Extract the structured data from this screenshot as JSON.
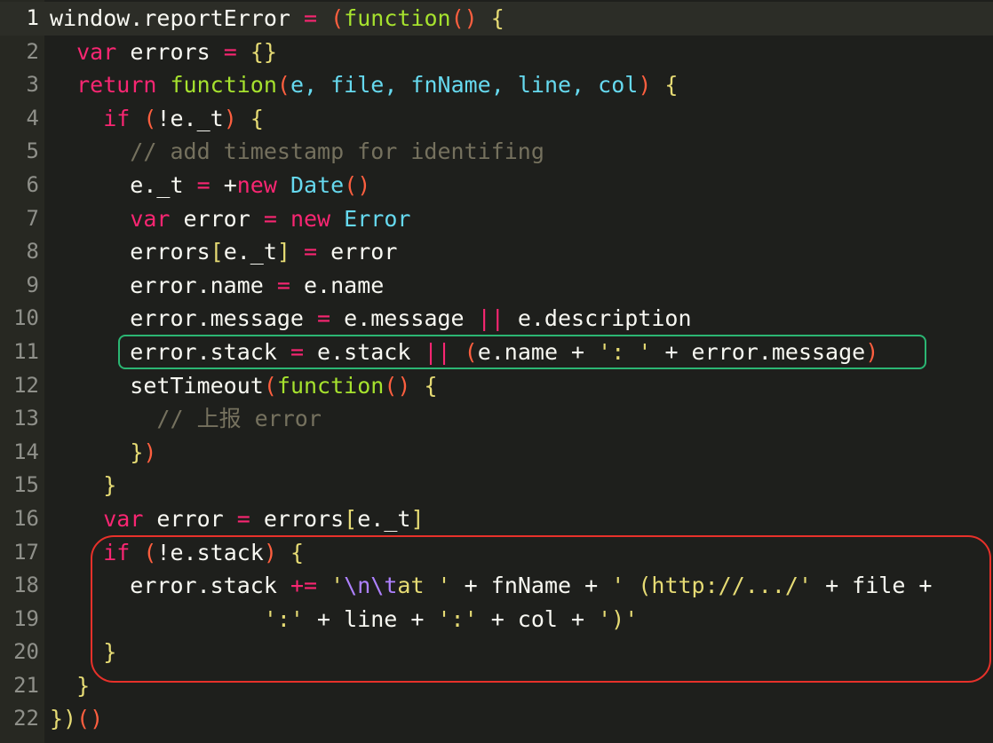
{
  "editor": {
    "line_numbers": [
      "1",
      "2",
      "3",
      "4",
      "5",
      "6",
      "7",
      "8",
      "9",
      "10",
      "11",
      "12",
      "13",
      "14",
      "15",
      "16",
      "17",
      "18",
      "19",
      "20",
      "21",
      "22"
    ],
    "active_line": "1",
    "colors": {
      "background": "#1e1f1c",
      "keyword": "#f92672",
      "function": "#a6e22e",
      "builtin": "#66d9ef",
      "string": "#e6db74",
      "comment": "#75715e",
      "highlight_green": "#2bb673",
      "highlight_red": "#e8312a"
    },
    "lines": [
      [
        {
          "t": "window.reportError ",
          "c": "w"
        },
        {
          "t": "=",
          "c": "k"
        },
        {
          "t": " ",
          "c": "w"
        },
        {
          "t": "(",
          "c": "p"
        },
        {
          "t": "function",
          "c": "f"
        },
        {
          "t": "()",
          "c": "p"
        },
        {
          "t": " {",
          "c": "y"
        }
      ],
      [
        {
          "t": "  ",
          "c": "w"
        },
        {
          "t": "var",
          "c": "k"
        },
        {
          "t": " errors ",
          "c": "w"
        },
        {
          "t": "=",
          "c": "k"
        },
        {
          "t": " ",
          "c": "w"
        },
        {
          "t": "{}",
          "c": "y"
        }
      ],
      [
        {
          "t": "  ",
          "c": "w"
        },
        {
          "t": "return",
          "c": "k"
        },
        {
          "t": " ",
          "c": "w"
        },
        {
          "t": "function",
          "c": "f"
        },
        {
          "t": "(",
          "c": "p"
        },
        {
          "t": "e, file, fnName, line, col",
          "c": "b"
        },
        {
          "t": ")",
          "c": "p"
        },
        {
          "t": " {",
          "c": "y"
        }
      ],
      [
        {
          "t": "    ",
          "c": "w"
        },
        {
          "t": "if",
          "c": "k"
        },
        {
          "t": " ",
          "c": "w"
        },
        {
          "t": "(",
          "c": "p"
        },
        {
          "t": "!e._t",
          "c": "w"
        },
        {
          "t": ")",
          "c": "p"
        },
        {
          "t": " {",
          "c": "y"
        }
      ],
      [
        {
          "t": "      // add timestamp for identifing",
          "c": "c"
        }
      ],
      [
        {
          "t": "      e._t ",
          "c": "w"
        },
        {
          "t": "=",
          "c": "k"
        },
        {
          "t": " +",
          "c": "w"
        },
        {
          "t": "new",
          "c": "k"
        },
        {
          "t": " ",
          "c": "w"
        },
        {
          "t": "Date",
          "c": "b"
        },
        {
          "t": "()",
          "c": "p"
        }
      ],
      [
        {
          "t": "      ",
          "c": "w"
        },
        {
          "t": "var",
          "c": "k"
        },
        {
          "t": " error ",
          "c": "w"
        },
        {
          "t": "=",
          "c": "k"
        },
        {
          "t": " ",
          "c": "w"
        },
        {
          "t": "new",
          "c": "k"
        },
        {
          "t": " ",
          "c": "w"
        },
        {
          "t": "Error",
          "c": "b"
        }
      ],
      [
        {
          "t": "      errors",
          "c": "w"
        },
        {
          "t": "[",
          "c": "y"
        },
        {
          "t": "e._t",
          "c": "w"
        },
        {
          "t": "]",
          "c": "y"
        },
        {
          "t": " ",
          "c": "w"
        },
        {
          "t": "=",
          "c": "k"
        },
        {
          "t": " error",
          "c": "w"
        }
      ],
      [
        {
          "t": "      error.name ",
          "c": "w"
        },
        {
          "t": "=",
          "c": "k"
        },
        {
          "t": " e.name",
          "c": "w"
        }
      ],
      [
        {
          "t": "      error.message ",
          "c": "w"
        },
        {
          "t": "=",
          "c": "k"
        },
        {
          "t": " e.message ",
          "c": "w"
        },
        {
          "t": "||",
          "c": "k"
        },
        {
          "t": " e.description",
          "c": "w"
        }
      ],
      [
        {
          "t": "      error.stack ",
          "c": "w"
        },
        {
          "t": "=",
          "c": "k"
        },
        {
          "t": " e.stack ",
          "c": "w"
        },
        {
          "t": "||",
          "c": "k"
        },
        {
          "t": " ",
          "c": "w"
        },
        {
          "t": "(",
          "c": "p"
        },
        {
          "t": "e.name + ",
          "c": "w"
        },
        {
          "t": "': '",
          "c": "s"
        },
        {
          "t": " + error.message",
          "c": "w"
        },
        {
          "t": ")",
          "c": "p"
        }
      ],
      [
        {
          "t": "      setTimeout",
          "c": "w"
        },
        {
          "t": "(",
          "c": "p"
        },
        {
          "t": "function",
          "c": "f"
        },
        {
          "t": "()",
          "c": "p"
        },
        {
          "t": " {",
          "c": "y"
        }
      ],
      [
        {
          "t": "        // 上报 error",
          "c": "c"
        }
      ],
      [
        {
          "t": "      ",
          "c": "w"
        },
        {
          "t": "}",
          "c": "y"
        },
        {
          "t": ")",
          "c": "p"
        }
      ],
      [
        {
          "t": "    ",
          "c": "w"
        },
        {
          "t": "}",
          "c": "y"
        }
      ],
      [
        {
          "t": "    ",
          "c": "w"
        },
        {
          "t": "var",
          "c": "k"
        },
        {
          "t": " error ",
          "c": "w"
        },
        {
          "t": "=",
          "c": "k"
        },
        {
          "t": " errors",
          "c": "w"
        },
        {
          "t": "[",
          "c": "y"
        },
        {
          "t": "e._t",
          "c": "w"
        },
        {
          "t": "]",
          "c": "y"
        }
      ],
      [
        {
          "t": "    ",
          "c": "w"
        },
        {
          "t": "if",
          "c": "k"
        },
        {
          "t": " ",
          "c": "w"
        },
        {
          "t": "(",
          "c": "p"
        },
        {
          "t": "!e.stack",
          "c": "w"
        },
        {
          "t": ")",
          "c": "p"
        },
        {
          "t": " {",
          "c": "y"
        }
      ],
      [
        {
          "t": "      error.stack ",
          "c": "w"
        },
        {
          "t": "+=",
          "c": "k"
        },
        {
          "t": " ",
          "c": "w"
        },
        {
          "t": "'",
          "c": "s"
        },
        {
          "t": "\\n\\t",
          "c": "esc"
        },
        {
          "t": "at '",
          "c": "s"
        },
        {
          "t": " + fnName + ",
          "c": "w"
        },
        {
          "t": "' (http://.../'",
          "c": "s"
        },
        {
          "t": " + file +",
          "c": "w"
        }
      ],
      [
        {
          "t": "                ",
          "c": "w"
        },
        {
          "t": "':'",
          "c": "s"
        },
        {
          "t": " + line + ",
          "c": "w"
        },
        {
          "t": "':'",
          "c": "s"
        },
        {
          "t": " + col + ",
          "c": "w"
        },
        {
          "t": "')'",
          "c": "s"
        }
      ],
      [
        {
          "t": "    ",
          "c": "w"
        },
        {
          "t": "}",
          "c": "y"
        }
      ],
      [
        {
          "t": "  ",
          "c": "w"
        },
        {
          "t": "}",
          "c": "y"
        }
      ],
      [
        {
          "t": "})",
          "c": "y"
        },
        {
          "t": "()",
          "c": "p"
        }
      ]
    ]
  }
}
